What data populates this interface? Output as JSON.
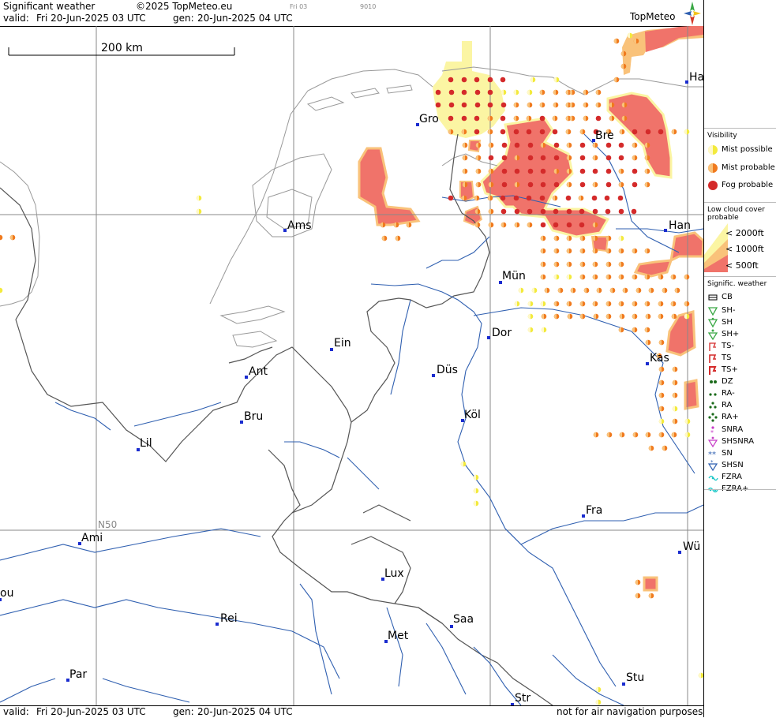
{
  "header": {
    "product": "Significant weather",
    "copyright": "©2025 TopMeteo.eu",
    "small_a": "Fri 03",
    "small_b": "9010",
    "valid_label": "valid:",
    "valid_value": "Fri  20-Jun-2025  03 UTC",
    "gen_label": "gen:",
    "gen_value": "20-Jun-2025 04 UTC",
    "logo": "TopMeteo"
  },
  "scale_label": "200 km",
  "grid_label": "N50",
  "footer": {
    "valid_label": "valid:",
    "valid_value": "Fri  20-Jun-2025  03 UTC",
    "gen_label": "gen:",
    "gen_value": "20-Jun-2025 04 UTC",
    "notice": "not for air navigation purposes"
  },
  "cities": [
    {
      "name": "Gro"
    },
    {
      "name": "Bre"
    },
    {
      "name": "Ha"
    },
    {
      "name": "Ams"
    },
    {
      "name": "Han"
    },
    {
      "name": "Mün"
    },
    {
      "name": "Dor"
    },
    {
      "name": "Ein"
    },
    {
      "name": "Ant"
    },
    {
      "name": "Düs"
    },
    {
      "name": "Kas"
    },
    {
      "name": "Bru"
    },
    {
      "name": "Köl"
    },
    {
      "name": "Lil"
    },
    {
      "name": "Ami"
    },
    {
      "name": "Fra"
    },
    {
      "name": "Wü"
    },
    {
      "name": "Lux"
    },
    {
      "name": "ou"
    },
    {
      "name": "Rei"
    },
    {
      "name": "Saa"
    },
    {
      "name": "Met"
    },
    {
      "name": "Par"
    },
    {
      "name": "Stu"
    },
    {
      "name": "Str"
    }
  ],
  "legend": {
    "visibility_title": "Visibility",
    "visibility": [
      "Mist possible",
      "Mist probable",
      "Fog probable"
    ],
    "cloud_title_1": "Low cloud cover",
    "cloud_title_2": "probable",
    "cloud": [
      "< 2000ft",
      "< 1000ft",
      "<  500ft"
    ],
    "sigwx_title": "Signific. weather",
    "sigwx": [
      "CB",
      "SH-",
      "SH",
      "SH+",
      "TS-",
      "TS",
      "TS+",
      "DZ",
      "RA-",
      "RA",
      "RA+",
      "SNRA",
      "SHSNRA",
      "SN",
      "SHSN",
      "FZRA",
      "FZRA+"
    ]
  },
  "colors": {
    "mist_possible": "#f3ea3c",
    "mist_probable": "#f07a1e",
    "fog_probable": "#d42a2a",
    "cloud_2000": "#fbf5a3",
    "cloud_1000": "#f9c27a",
    "cloud_500": "#f0736a",
    "coast": "#999999",
    "border": "#555555",
    "river": "#2f5fb0",
    "grid": "#888888"
  }
}
